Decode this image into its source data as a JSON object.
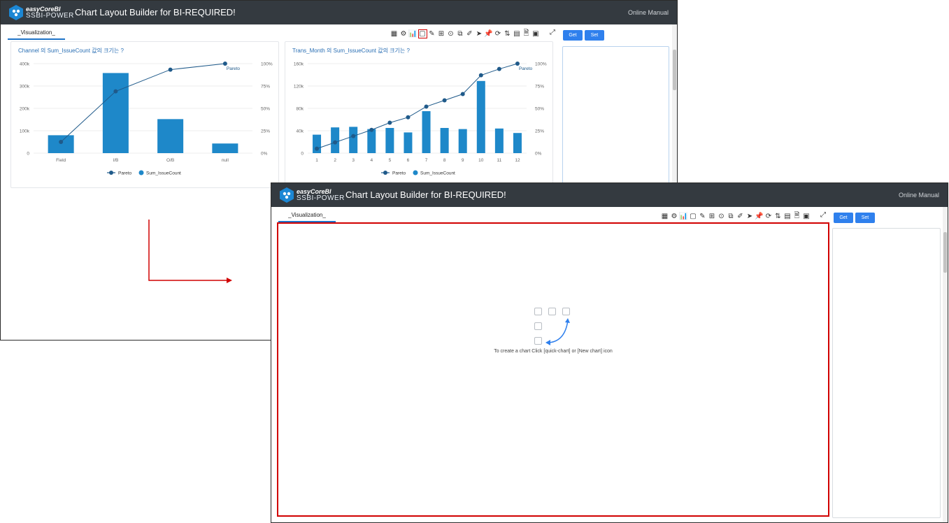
{
  "app": {
    "logo_line1": "easyCoreBI",
    "logo_line2": "SSBI-POWER",
    "title": "Chart Layout Builder for BI-REQUIRED!",
    "online_manual": "Online Manual"
  },
  "tab": {
    "label": "_Visualization_"
  },
  "toolbar": {
    "icons": [
      {
        "name": "table-icon",
        "glyph": "▦"
      },
      {
        "name": "settings-icon",
        "glyph": "⚙"
      },
      {
        "name": "bar-chart-icon",
        "glyph": "📊"
      },
      {
        "name": "new-chart-icon",
        "glyph": "▢"
      },
      {
        "name": "edit-icon",
        "glyph": "✎"
      },
      {
        "name": "plus-square-icon",
        "glyph": "⊞"
      },
      {
        "name": "target-icon",
        "glyph": "⊙"
      },
      {
        "name": "copy-icon",
        "glyph": "⧉"
      },
      {
        "name": "attach-icon",
        "glyph": "✐"
      },
      {
        "name": "send-icon",
        "glyph": "➤"
      },
      {
        "name": "pin-icon",
        "glyph": "📌"
      },
      {
        "name": "refresh-icon",
        "glyph": "⟳"
      },
      {
        "name": "sort-icon",
        "glyph": "⇅"
      },
      {
        "name": "calculator-icon",
        "glyph": "▤"
      },
      {
        "name": "excel-icon",
        "glyph": "🗎"
      },
      {
        "name": "camera-icon",
        "glyph": "▣"
      }
    ],
    "highlighted_icon": "new-chart-icon",
    "expand_icon": "⤢"
  },
  "buttons": {
    "get": "Get",
    "set": "Set"
  },
  "chart_data": [
    {
      "type": "bar",
      "title": "Channel 의 Sum_IssueCount 값의 크기는 ?",
      "categories": [
        "Field",
        "I/B",
        "O/B",
        "null"
      ],
      "series": [
        {
          "name": "Sum_IssueCount",
          "type": "bar",
          "values": [
            80000,
            358000,
            152000,
            43000
          ],
          "color": "#1e88c9"
        },
        {
          "name": "Pareto",
          "type": "line",
          "axis": "right",
          "values": [
            12.5,
            69,
            93.3,
            100
          ],
          "color": "#1f5a8a"
        }
      ],
      "ylim": [
        0,
        400000
      ],
      "y_ticks": [
        "0",
        "100k",
        "200k",
        "300k",
        "400k"
      ],
      "y2lim": [
        0,
        100
      ],
      "y2_ticks": [
        "0%",
        "25%",
        "50%",
        "75%",
        "100%"
      ],
      "line_label": "Pareto",
      "legend": [
        "Pareto",
        "Sum_IssueCount"
      ],
      "legend_position": "bottom",
      "grid": true
    },
    {
      "type": "bar",
      "title": "Trans_Month 의 Sum_IssueCount 값의 크기는 ?",
      "categories": [
        "1",
        "2",
        "3",
        "4",
        "5",
        "6",
        "7",
        "8",
        "9",
        "10",
        "11",
        "12"
      ],
      "series": [
        {
          "name": "Sum_IssueCount",
          "type": "bar",
          "values": [
            33000,
            46000,
            47000,
            43000,
            45000,
            37000,
            75000,
            45000,
            43000,
            129000,
            44000,
            36000
          ],
          "color": "#1e88c9"
        },
        {
          "name": "Pareto",
          "type": "line",
          "axis": "right",
          "values": [
            5,
            12,
            19,
            26,
            34,
            40,
            52,
            59,
            66,
            87,
            94,
            100
          ],
          "color": "#1f5a8a"
        }
      ],
      "ylim": [
        0,
        160000
      ],
      "y_ticks": [
        "0",
        "40k",
        "80k",
        "120k",
        "160k"
      ],
      "y2lim": [
        0,
        100
      ],
      "y2_ticks": [
        "0%",
        "25%",
        "50%",
        "75%",
        "100%"
      ],
      "line_label": "Pareto",
      "legend": [
        "Pareto",
        "Sum_IssueCount"
      ],
      "legend_position": "bottom",
      "grid": true
    }
  ],
  "empty_state": {
    "message": "To create a chart Click [quick-chart] or [New chart] icon"
  },
  "colors": {
    "header": "#343a40",
    "accent": "#2f80ed",
    "bar": "#1e88c9",
    "line": "#1f5a8a",
    "highlight": "#d10000"
  }
}
